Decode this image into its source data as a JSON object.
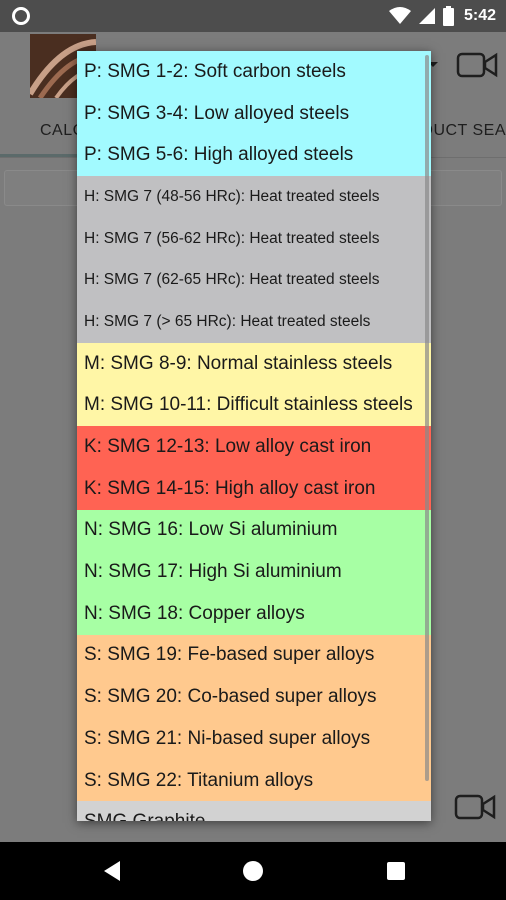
{
  "status_bar": {
    "time": "5:42"
  },
  "app": {
    "tab_left_label": "CALC",
    "tab_right_label": "DUCT SEA"
  },
  "colors": {
    "P": "#a2faff",
    "H": "#c0c0c2",
    "M": "#fff6a6",
    "K": "#ff6353",
    "N": "#a7ffa4",
    "S": "#ffc98e",
    "other": "#d2d2d2"
  },
  "material_list": {
    "items": [
      {
        "label": "P: SMG 1-2: Soft carbon steels",
        "group": "P"
      },
      {
        "label": "P: SMG 3-4: Low alloyed steels",
        "group": "P"
      },
      {
        "label": "P: SMG 5-6: High alloyed steels",
        "group": "P"
      },
      {
        "label": "H: SMG 7 (48-56 HRc): Heat treated steels",
        "group": "H"
      },
      {
        "label": "H: SMG 7 (56-62 HRc): Heat treated steels",
        "group": "H"
      },
      {
        "label": "H: SMG 7 (62-65 HRc): Heat treated steels",
        "group": "H"
      },
      {
        "label": "H: SMG 7 (> 65 HRc): Heat treated steels",
        "group": "H"
      },
      {
        "label": "M: SMG 8-9: Normal stainless steels",
        "group": "M"
      },
      {
        "label": "M: SMG 10-11: Difficult stainless steels",
        "group": "M"
      },
      {
        "label": "K: SMG 12-13: Low alloy cast iron",
        "group": "K"
      },
      {
        "label": "K: SMG 14-15: High alloy cast iron",
        "group": "K"
      },
      {
        "label": "N: SMG 16: Low Si aluminium",
        "group": "N"
      },
      {
        "label": "N: SMG 17: High Si aluminium",
        "group": "N"
      },
      {
        "label": "N: SMG 18: Copper alloys",
        "group": "N"
      },
      {
        "label": "S: SMG 19: Fe-based super alloys",
        "group": "S"
      },
      {
        "label": "S: SMG 20: Co-based super alloys",
        "group": "S"
      },
      {
        "label": "S: SMG 21: Ni-based super alloys",
        "group": "S"
      },
      {
        "label": "S: SMG 22: Titanium alloys",
        "group": "S"
      },
      {
        "label": "SMG Graphite",
        "group": "other"
      }
    ]
  }
}
